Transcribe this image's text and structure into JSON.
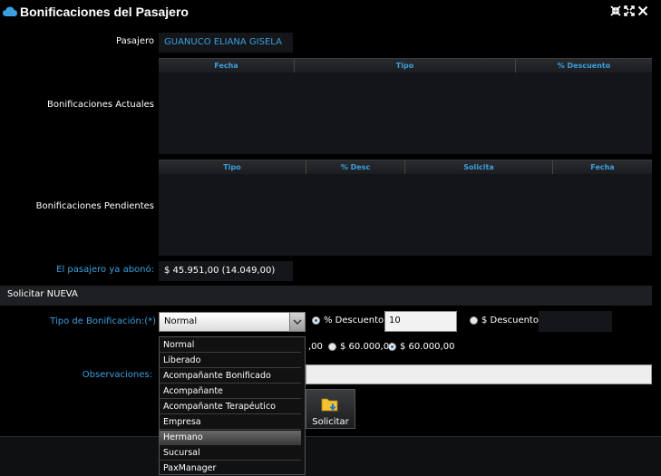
{
  "window": {
    "title": "Bonificaciones del Pasajero",
    "controls": [
      "collapse-icon",
      "expand-icon",
      "close-icon"
    ]
  },
  "pasajero": {
    "label": "Pasajero",
    "value": "GUANUCO ELIANA GISELA"
  },
  "actuales": {
    "label": "Bonificaciones Actuales",
    "columns": [
      "Fecha",
      "Tipo",
      "% Descuento"
    ]
  },
  "pendientes": {
    "label": "Bonificaciones Pendientes",
    "columns": [
      "Tipo",
      "% Desc",
      "Solicita",
      "Fecha"
    ]
  },
  "abono": {
    "label": "El pasajero ya abonó:",
    "value": "$ 45.951,00 (14.049,00)"
  },
  "nueva": {
    "section_title": "Solicitar NUEVA",
    "tipo_label": "Tipo de Bonificación:(*)",
    "tipo_selected": "Normal",
    "tipo_options": [
      "Normal",
      "Liberado",
      "Acompañante Bonificado",
      "Acompañante",
      "Acompañante Terapéutico",
      "Empresa",
      "Hermano",
      "Sucursal",
      "PaxManager"
    ],
    "highlighted_option": "Hermano",
    "pct_radio_label": "% Descuento",
    "pct_value": "10",
    "monto_radio_label": "$ Descuento",
    "monto_value": "",
    "amount_partial": ",00",
    "amount_option_1": "$ 60.000,00",
    "amount_option_2": "$ 60.000,00",
    "obs_label": "Observaciones:",
    "obs_value": "",
    "solicitar_label": "Solicitar"
  },
  "colors": {
    "accent": "#3aa0e0",
    "background": "#000000"
  }
}
